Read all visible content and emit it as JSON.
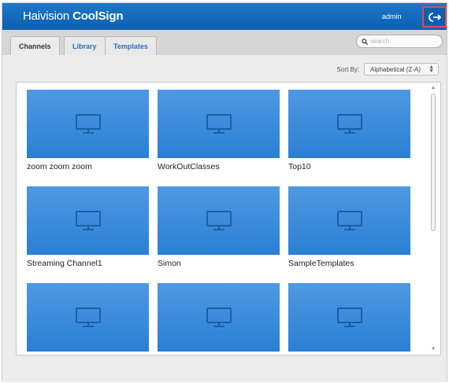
{
  "header": {
    "brand_part1": "Haivision",
    "brand_part2": "CoolSign",
    "username": "admin",
    "logout_icon": "logout-icon",
    "accent": "#0b5fb0",
    "highlight": "#e34a4a"
  },
  "tabs": [
    {
      "label": "Channels",
      "active": true
    },
    {
      "label": "Library",
      "active": false
    },
    {
      "label": "Templates",
      "active": false
    }
  ],
  "search": {
    "placeholder": "search",
    "value": ""
  },
  "sort": {
    "label": "Sort By:",
    "selected": "Alphabetical (Z-A)"
  },
  "channels": [
    {
      "name": "zoom zoom zoom"
    },
    {
      "name": "WorkOutClasses"
    },
    {
      "name": "Top10"
    },
    {
      "name": "Streaming Channel1"
    },
    {
      "name": "Simon"
    },
    {
      "name": "SampleTemplates"
    },
    {
      "name": ""
    },
    {
      "name": ""
    },
    {
      "name": ""
    }
  ]
}
